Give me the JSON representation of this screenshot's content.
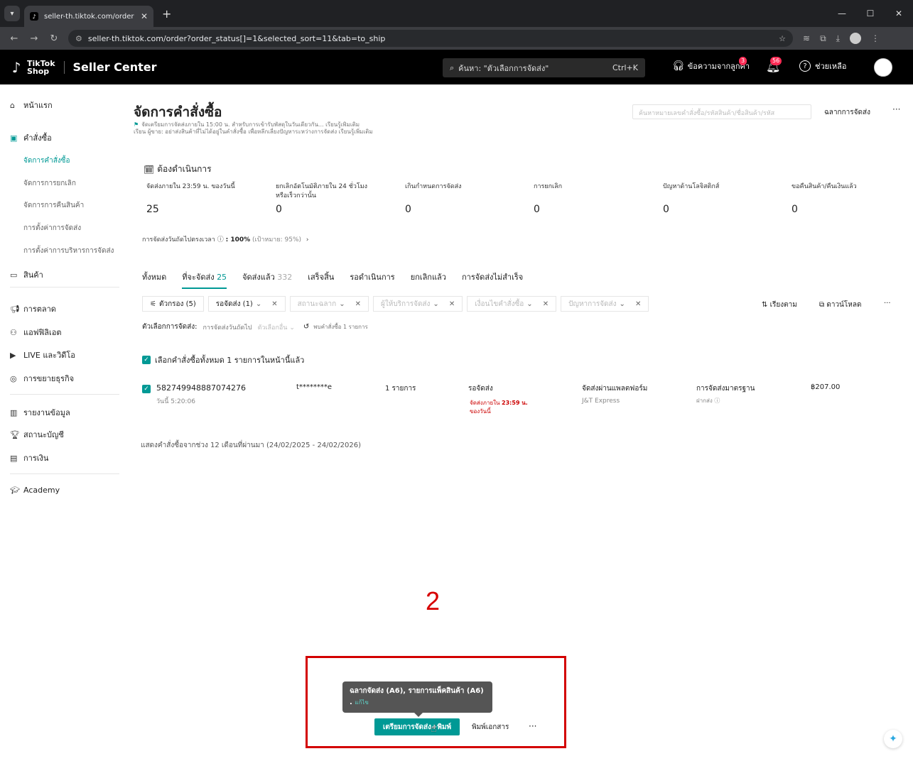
{
  "browser": {
    "tab_title": "seller-th.tiktok.com/order",
    "url": "seller-th.tiktok.com/order?order_status[]=1&selected_sort=11&tab=to_ship"
  },
  "header": {
    "brand_line1": "TikTok",
    "brand_line2": "Shop",
    "app_title": "Seller Center",
    "search_placeholder": "ค้นหา: \"ตัวเลือกการจัดส่ง\"",
    "search_shortcut": "Ctrl+K",
    "messages_label": "ข้อความจากลูกค้า",
    "messages_badge": "3",
    "notifications_badge": "56",
    "help_label": "ช่วยเหลือ"
  },
  "sidebar": {
    "home": "หน้าแรก",
    "orders": "คำสั่งซื้อ",
    "orders_sub": [
      "จัดการคำสั่งซื้อ",
      "จัดการการยกเลิก",
      "จัดการการคืนสินค้า",
      "การตั้งค่าการจัดส่ง",
      "การตั้งค่าการบริหารการจัดส่ง"
    ],
    "products": "สินค้า",
    "marketing": "การตลาด",
    "affiliate": "แอฟฟิลิเอต",
    "live_video": "LIVE และวิดีโอ",
    "growth": "การขยายธุรกิจ",
    "data_report": "รายงานข้อมูล",
    "account_health": "สถานะบัญชี",
    "finance": "การเงิน",
    "academy": "Academy"
  },
  "main": {
    "title": "จัดการคำสั่งซื้อ",
    "order_search_placeholder": "ค้นหาหมายเลขคำสั่งซื้อ/รหัสสินค้า/ชื่อสินค้า/รหัส",
    "shipping_labels": "ฉลากการจัดส่ง",
    "banner_line1": "จัดเตรียมการจัดส่งภายใน 15:00 น. สำหรับการเข้ารับพัสดุในวันเดียวกัน... เรียนรู้เพิ่มเติม",
    "banner_line2": "เรียน ผู้ขาย: อย่าส่งสินค้าที่ไม่ได้อยู่ในคำสั่งซื้อ เพื่อหลีกเลี่ยงปัญหาระหว่างการจัดส่ง เรียนรู้เพิ่มเติม",
    "todo_title": "ต้องดำเนินการ",
    "stats": [
      {
        "label": "จัดส่งภายใน 23:59 น. ของวันนี้",
        "value": "25"
      },
      {
        "label": "ยกเลิกอัตโนมัติภายใน 24 ชั่วโมงหรือเร็วกว่านั้น",
        "value": "0"
      },
      {
        "label": "เกินกำหนดการจัดส่ง",
        "value": "0"
      },
      {
        "label": "การยกเลิก",
        "value": "0"
      },
      {
        "label": "ปัญหาด้านโลจิสติกส์",
        "value": "0"
      },
      {
        "label": "ขอคืนสินค้า/คืนเงินแล้ว",
        "value": "0"
      }
    ],
    "ontime_label": "การจัดส่งวันถัดไปตรงเวลา",
    "ontime_value": ": 100%",
    "ontime_target": "(เป้าหมาย: 95%)",
    "tabs": [
      {
        "label": "ทั้งหมด",
        "count": ""
      },
      {
        "label": "ที่จะจัดส่ง",
        "count": "25"
      },
      {
        "label": "จัดส่งแล้ว",
        "count": "332"
      },
      {
        "label": "เสร็จสิ้น",
        "count": ""
      },
      {
        "label": "รอดำเนินการ",
        "count": ""
      },
      {
        "label": "ยกเลิกแล้ว",
        "count": ""
      },
      {
        "label": "การจัดส่งไม่สำเร็จ",
        "count": ""
      }
    ],
    "filters": {
      "filter_label": "ตัวกรอง",
      "filter_count": "(5)",
      "status": "รอจัดส่ง (1)",
      "label_status": "สถานะฉลาก",
      "provider": "ผู้ให้บริการจัดส่ง",
      "order_type": "เงื่อนไขคำสั่งซื้อ",
      "issue": "ปัญหาการจัดส่ง",
      "sort": "เรียงตาม",
      "download": "ดาวน์โหลด"
    },
    "ship_options_label": "ตัวเลือกการจัดส่ง:",
    "ship_option_next_day": "การจัดส่งวันถัดไป",
    "ship_option_other": "ตัวเลือกอื่น",
    "found_text": "พบคำสั่งซื้อ 1 รายการ",
    "select_all_text": "เลือกคำสั่งซื้อทั้งหมด 1 รายการในหน้านี้แล้ว",
    "order": {
      "id": "582749948887074276",
      "time": "วันนี้ 5:20:06",
      "buyer": "t********e",
      "items": "1 รายการ",
      "status": "รอจัดส่ง",
      "deadline_prefix": "จัดส่งภายใน",
      "deadline_time": "23:59 น.",
      "deadline_suffix": "ของวันนี้",
      "shipping_method": "จัดส่งผ่านแพลตฟอร์ม",
      "carrier": "J&T Express",
      "delivery_option": "การจัดส่งมาตรฐาน",
      "delivery_sub": "ฝากส่ง",
      "amount": "฿207.00"
    },
    "history_note": "แสดงคำสั่งซื้อจากช่วง 12 เดือนที่ผ่านมา (24/02/2025 - 24/02/2026)"
  },
  "annotation_number": "2",
  "tooltip": {
    "text": "ฉลากจัดส่ง (A6), รายการแพ็คสินค้า (A6) .",
    "link": "แก้ไข"
  },
  "actions": {
    "prepare_print": "เตรียมการจัดส่ง+พิมพ์",
    "print_docs": "พิมพ์เอกสาร",
    "more": "···"
  },
  "colors": {
    "accent": "#009995",
    "annotation_red": "#d30000",
    "header_bg": "#000000"
  }
}
